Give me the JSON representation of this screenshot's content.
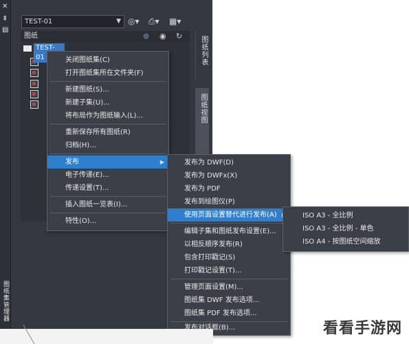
{
  "palette": {
    "combo_value": "TEST-01",
    "sheets_header": "图纸",
    "root_node": "TEST-01",
    "tree_items": [
      "",
      "",
      "",
      "",
      "",
      ""
    ],
    "tab_sheet_list": "图纸列表",
    "tab_sheet_views": "图纸视图",
    "title": "图纸集管理器"
  },
  "menu_primary": [
    "关闭图纸集(C)",
    "打开图纸集所在文件夹(F)",
    "新建图纸(S)...",
    "新建子集(U)...",
    "将布局作为图纸输入(L)...",
    "重新保存所有图纸(R)",
    "归档(H)...",
    "发布",
    "电子传递(E)...",
    "传递设置(T)...",
    "插入图纸一览表(I)...",
    "特性(O)..."
  ],
  "menu_publish": [
    "发布为 DWF(D)",
    "发布为 DWFx(X)",
    "发布为 PDF",
    "发布到绘图仪(P)",
    "使用页面设置替代进行发布(A)",
    "编辑子集和图纸发布设置(E)...",
    "以相反顺序发布(R)",
    "包含打印戳记(S)",
    "打印戳记设置(T)...",
    "管理页面设置(M)...",
    "图纸集 DWF 发布选项...",
    "图纸集 PDF 发布选项...",
    "发布对话框(B)..."
  ],
  "menu_override": [
    "ISO A3 - 全比例",
    "ISO A3 - 全比例 - 单色",
    "ISO A4 - 按图纸空间缩放"
  ],
  "watermark": "看看手游网",
  "colors": {
    "highlight": "#2f7fcf",
    "menu_bg": "#3b4048",
    "palette_bg": "#33373f"
  }
}
